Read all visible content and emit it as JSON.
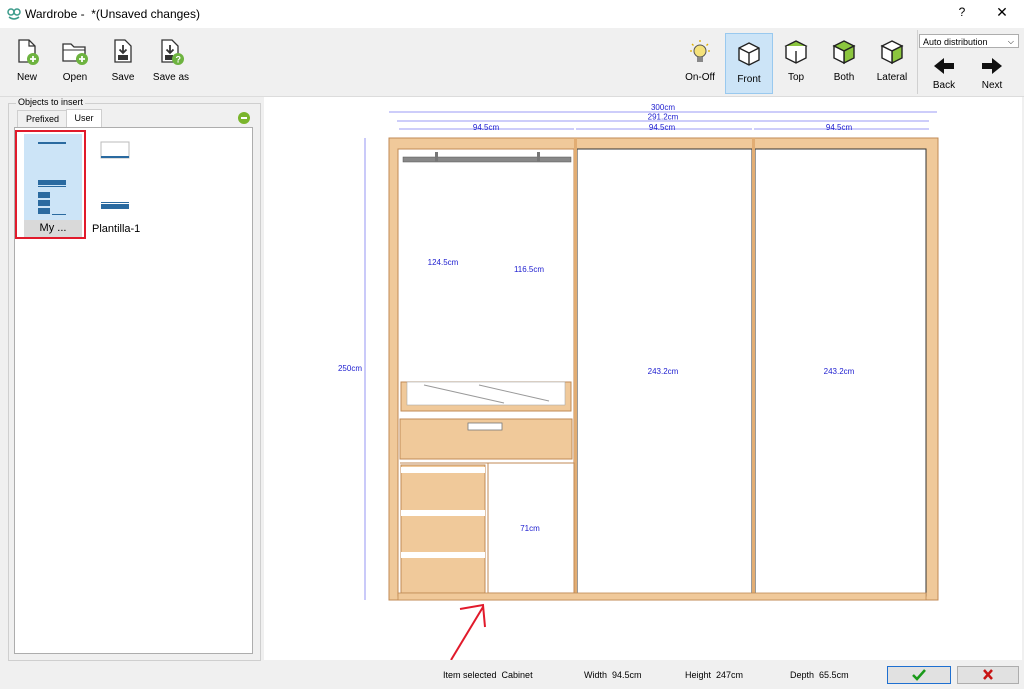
{
  "window": {
    "app_name": "Wardrobe -",
    "subtitle": "*(Unsaved changes)",
    "help": "?",
    "close": "✕"
  },
  "toolbar": {
    "new_label": "New",
    "open_label": "Open",
    "save_label": "Save",
    "save_as_label": "Save as",
    "onoff_label": "On-Off",
    "front_label": "Front",
    "top_label": "Top",
    "both_label": "Both",
    "lateral_label": "Lateral",
    "back_label": "Back",
    "next_label": "Next",
    "distribution_selected": "Auto distribution"
  },
  "panel": {
    "group_title": "Objects to insert",
    "tabs": [
      "Prefixed",
      "User"
    ],
    "active_tab": "User",
    "items": [
      {
        "label": "My ...",
        "selected": true
      },
      {
        "label": "Plantilla-1",
        "selected": false
      }
    ]
  },
  "drawing": {
    "total_width": "300cm",
    "inner_width": "291.2cm",
    "module_widths": [
      "94.5cm",
      "94.5cm",
      "94.5cm"
    ],
    "height": "250cm",
    "hang_left": "124.5cm",
    "hang_right": "116.5cm",
    "door_mid": "243.2cm",
    "door_right": "243.2cm",
    "lower_right": "71cm"
  },
  "status": {
    "item_selected_label": "Item selected",
    "item_selected_value": "Cabinet",
    "width_label": "Width",
    "width_value": "94.5cm",
    "height_label": "Height",
    "height_value": "247cm",
    "depth_label": "Depth",
    "depth_value": "65.5cm"
  },
  "colors": {
    "wood": "#f0c99a",
    "wood_edge": "#c08a55",
    "dimension": "#2020d0",
    "selection_red": "#e11a2b",
    "active_button": "#cce4f7",
    "ok_green": "#1a9a1a",
    "cancel_red": "#c81414"
  }
}
